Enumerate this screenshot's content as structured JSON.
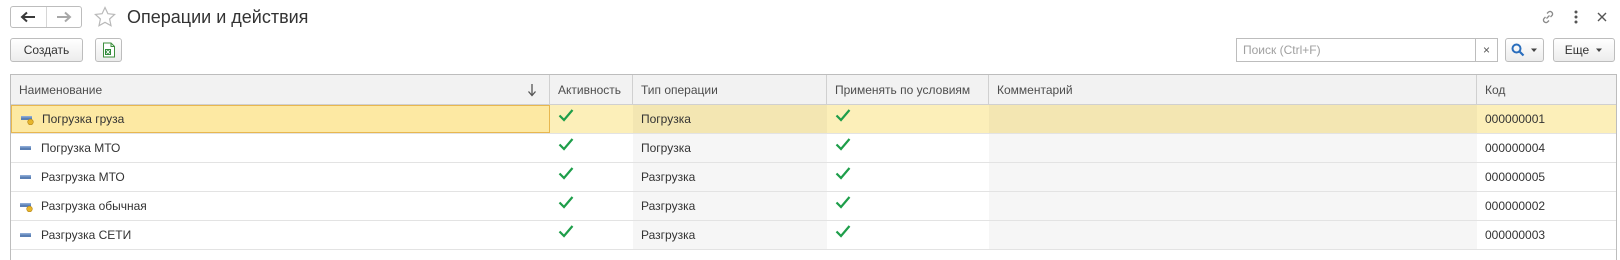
{
  "window": {
    "title": "Операции и действия",
    "back_icon": "arrow-left-icon",
    "forward_icon": "arrow-right-icon",
    "favorite_icon": "star-icon",
    "link_icon": "link-icon",
    "more_icon": "more-vertical-icon",
    "close_icon": "close-icon"
  },
  "toolbar": {
    "create_label": "Создать",
    "excel_icon": "excel-document-icon",
    "search_placeholder": "Поиск (Ctrl+F)",
    "search_value": "",
    "clear_label": "×",
    "search_icon": "search-icon",
    "more_label": "Еще"
  },
  "table": {
    "columns": [
      {
        "label": "Наименование"
      },
      {
        "label": "Активность"
      },
      {
        "label": "Тип операции"
      },
      {
        "label": "Применять по условиям"
      },
      {
        "label": "Комментарий"
      },
      {
        "label": "Код"
      }
    ],
    "rows": [
      {
        "name": "Погрузка груза",
        "icon": "item-with-condition-icon",
        "active": true,
        "type": "Погрузка",
        "apply_by_conditions": true,
        "comment": "",
        "code": "000000001",
        "selected": true
      },
      {
        "name": "Погрузка МТО",
        "icon": "item-icon",
        "active": true,
        "type": "Погрузка",
        "apply_by_conditions": true,
        "comment": "",
        "code": "000000004",
        "selected": false
      },
      {
        "name": "Разгрузка МТО",
        "icon": "item-icon",
        "active": true,
        "type": "Разгрузка",
        "apply_by_conditions": true,
        "comment": "",
        "code": "000000005",
        "selected": false
      },
      {
        "name": "Разгрузка обычная",
        "icon": "item-with-condition-icon",
        "active": true,
        "type": "Разгрузка",
        "apply_by_conditions": true,
        "comment": "",
        "code": "000000002",
        "selected": false
      },
      {
        "name": "Разгрузка СЕТИ",
        "icon": "item-icon",
        "active": true,
        "type": "Разгрузка",
        "apply_by_conditions": true,
        "comment": "",
        "code": "000000003",
        "selected": false
      }
    ]
  },
  "colors": {
    "selection": "#fcefb9",
    "selection_border": "#e8b74f",
    "check": "#1e9e4a",
    "accent": "#2a6ebd"
  }
}
